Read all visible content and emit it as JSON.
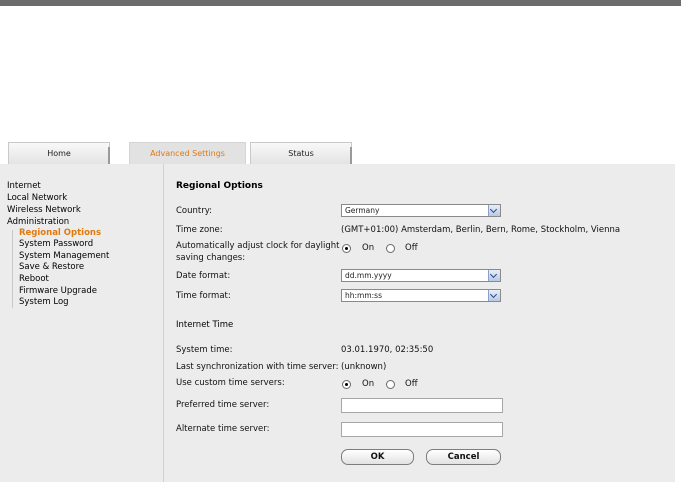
{
  "tabs": [
    {
      "label": "Home",
      "active": false
    },
    {
      "label": "Advanced Settings",
      "active": true
    },
    {
      "label": "Status",
      "active": false
    }
  ],
  "nav": {
    "top": [
      "Internet",
      "Local Network",
      "Wireless Network",
      "Administration"
    ],
    "sub": [
      "Regional Options",
      "System Password",
      "System Management",
      "Save & Restore",
      "Reboot",
      "Firmware Upgrade",
      "System Log"
    ],
    "active": "Regional Options"
  },
  "page": {
    "title": "Regional Options",
    "country_label": "Country:",
    "country_value": "Germany",
    "timezone_label": "Time zone:",
    "timezone_value": "(GMT+01:00) Amsterdam, Berlin, Bern, Rome, Stockholm, Vienna",
    "dst_label_line1": "Automatically adjust clock for daylight",
    "dst_label_line2": "saving changes:",
    "dst_on": "On",
    "dst_off": "Off",
    "date_format_label": "Date format:",
    "date_format_value": "dd.mm.yyyy",
    "time_format_label": "Time format:",
    "time_format_value": "hh:mm:ss",
    "internet_time_heading": "Internet Time",
    "system_time_label": "System time:",
    "system_time_value": "03.01.1970, 02:35:50",
    "last_sync_label": "Last synchronization with time server:",
    "last_sync_value": "(unknown)",
    "custom_servers_label": "Use custom time servers:",
    "custom_on": "On",
    "custom_off": "Off",
    "preferred_label": "Preferred time server:",
    "preferred_value": "",
    "alternate_label": "Alternate time server:",
    "alternate_value": "",
    "ok_label": "OK",
    "cancel_label": "Cancel"
  },
  "colors": {
    "accent": "#e07a10",
    "panel": "#ececec",
    "topbar": "#6b6b6b"
  }
}
